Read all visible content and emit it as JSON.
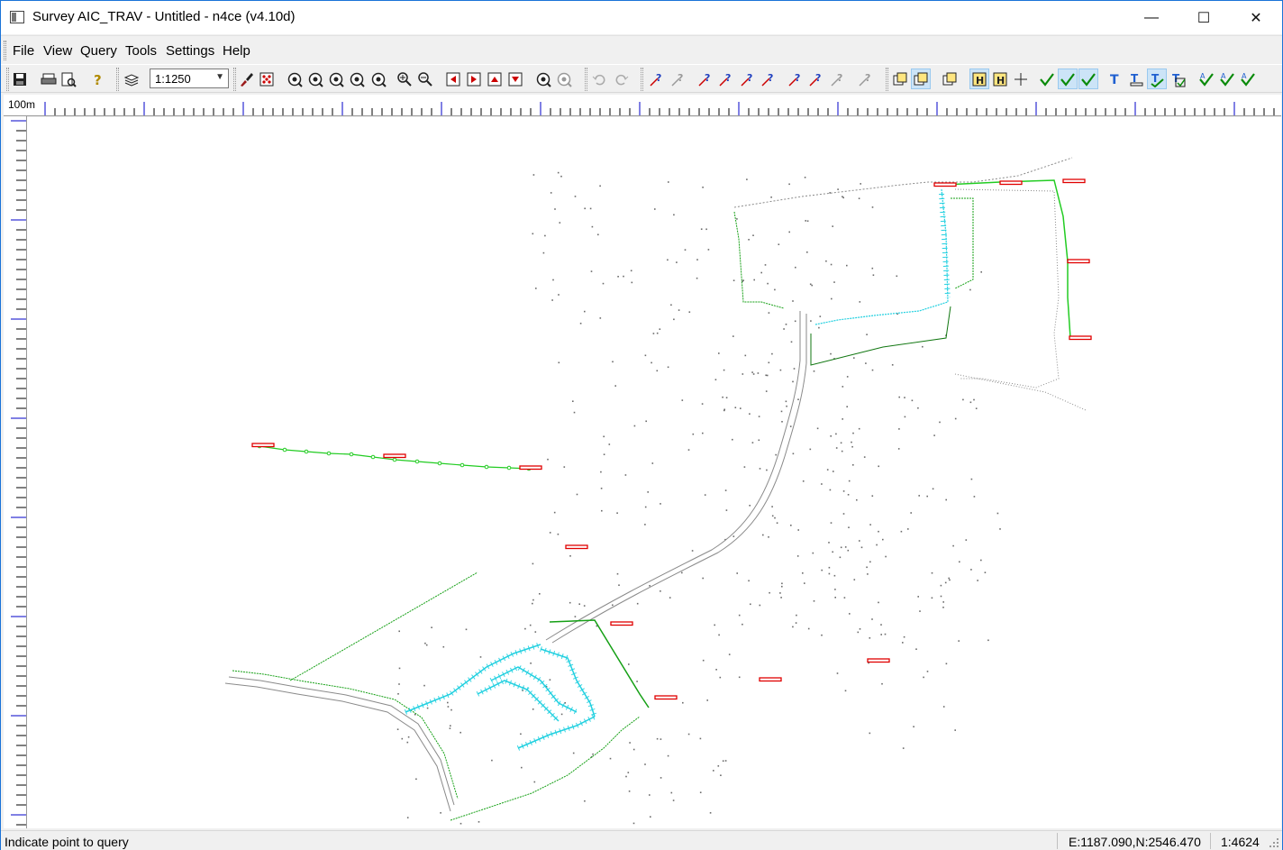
{
  "window": {
    "title": "Survey AIC_TRAV - Untitled - n4ce (v4.10d)",
    "minimize_glyph": "—",
    "maximize_glyph": "☐",
    "close_glyph": "✕"
  },
  "menu": {
    "items": [
      "File",
      "View",
      "Query",
      "Tools",
      "Settings",
      "Help"
    ]
  },
  "toolbar": {
    "scale_value": "1:1250",
    "buttons": [
      "save-icon",
      "print-icon",
      "print-preview-icon",
      "help-query-icon",
      "layers-icon",
      "paint-brush-icon",
      "dice-icon",
      "zoom-previous-icon",
      "zoom-all-icon",
      "zoom-window-icon",
      "zoom-extents-icon",
      "zoom-scale-icon",
      "zoom-in-icon",
      "zoom-out-icon",
      "pan-left-icon",
      "pan-right-icon",
      "pan-up-icon",
      "pan-down-icon",
      "query-zoom-icon",
      "query-zoom-disabled-icon",
      "undo-icon",
      "redo-icon",
      "query-point-icon",
      "query-angle-icon",
      "query-line-icon",
      "query-polyline-icon",
      "query-circle-icon",
      "query-area-icon",
      "query-distance-icon",
      "query-bearing-icon",
      "query-triangle-icon",
      "query-disabled-icon",
      "select-box-icon",
      "select-filter-icon",
      "bitmap-icon",
      "snap-grid-icon",
      "snap-height-icon",
      "crosshair-icon",
      "check-icon",
      "check-plus-icon",
      "check-shield-icon",
      "text-icon",
      "text-underline-icon",
      "text-check-icon",
      "text-edit-icon",
      "spell-check-a-icon",
      "spell-check-abc-icon",
      "spell-check-ab-icon"
    ]
  },
  "ruler": {
    "label": "100m"
  },
  "canvas": {
    "colors": {
      "points": "#6b6b6b",
      "lines": "#8a8a8a",
      "traverse": "#22cc22",
      "hatch": "#22d0e0",
      "labels": "#e00000",
      "green_line": "#15a015"
    }
  },
  "status": {
    "message": "Indicate point to query",
    "coords": "E:1187.090,N:2546.470",
    "scale": "1:4624"
  }
}
